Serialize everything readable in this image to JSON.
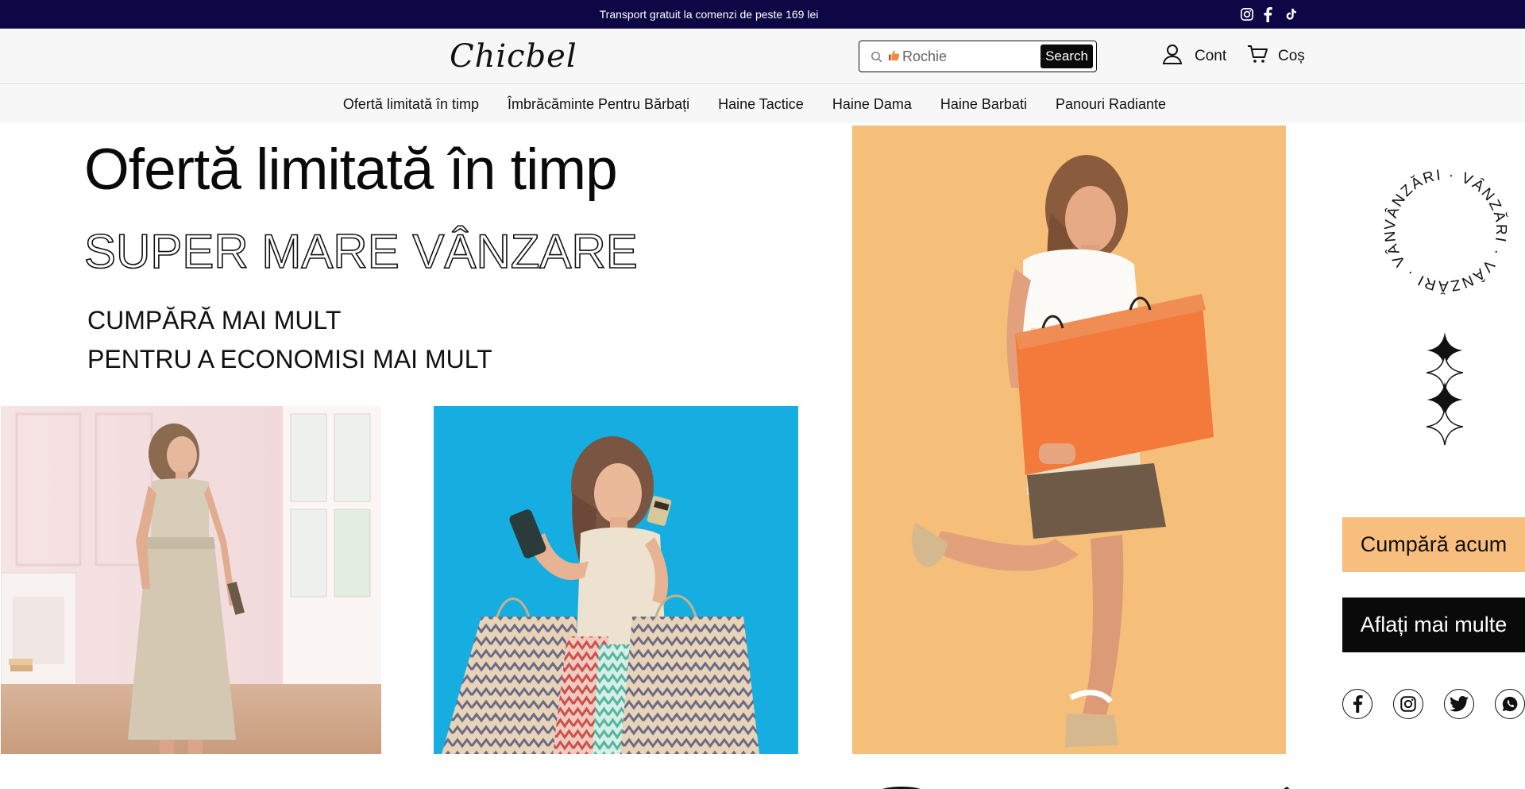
{
  "announcement": {
    "text": "Transport gratuit la comenzi de peste 169 lei"
  },
  "top_social": [
    "instagram-icon",
    "facebook-icon",
    "tiktok-icon"
  ],
  "header": {
    "logo": "Chicbel",
    "search": {
      "placeholder": "Rochie",
      "button_label": "Search"
    },
    "account_label": "Cont",
    "cart_label": "Coș"
  },
  "nav": {
    "items": [
      "Ofertă limitată în timp",
      "Îmbrăcăminte Pentru Bărbați",
      "Haine Tactice",
      "Haine Dama",
      "Haine Barbati",
      "Panouri Radiante"
    ]
  },
  "hero": {
    "title": "Ofertă limitată în timp",
    "sale": "SUPER MARE VÂNZARE",
    "line1": "CUMPĂRĂ MAI MULT",
    "line2": "PENTRU A ECONOMISI MAI MULT"
  },
  "badge": {
    "circle_text": "VÂNZĂRI · VÂNZĂRI · VÂNZĂRI · VÂNZĂRI · "
  },
  "buttons": {
    "shop_now": "Cumpără acum",
    "learn_more": "Aflați mai multe"
  },
  "side_social": [
    "facebook-icon",
    "instagram-icon",
    "twitter-icon",
    "whatsapp-icon"
  ],
  "colors": {
    "announcement_bg": "#0e0745",
    "shop_button_bg": "#f8be7d",
    "learn_button_bg": "#0a0a0a",
    "photo2_bg": "#16aee0",
    "photo3_bg": "#f5bf7a"
  }
}
